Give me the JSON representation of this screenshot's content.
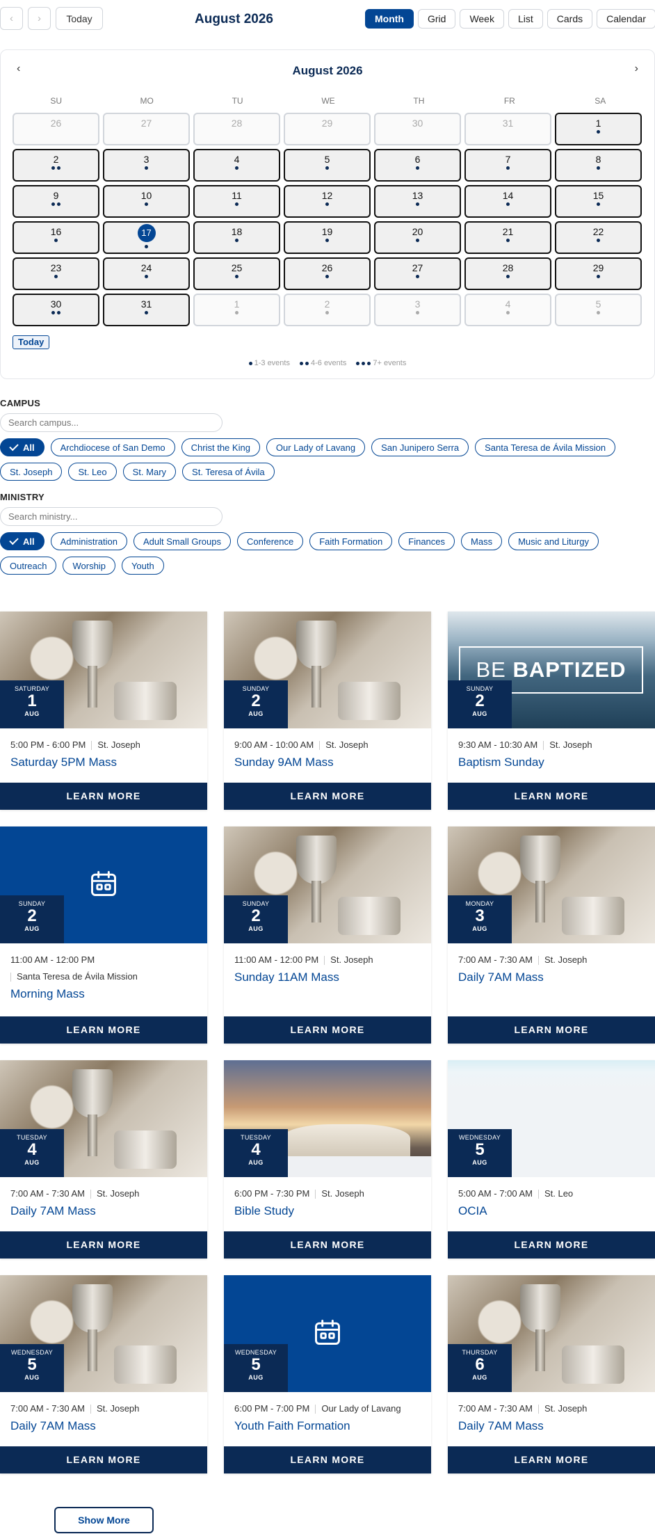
{
  "toolbar": {
    "prev_label": "‹",
    "next_label": "›",
    "today_label": "Today",
    "title": "August 2026",
    "views": [
      {
        "label": "Month",
        "active": true
      },
      {
        "label": "Grid",
        "active": false
      },
      {
        "label": "Week",
        "active": false
      },
      {
        "label": "List",
        "active": false
      },
      {
        "label": "Cards",
        "active": false
      },
      {
        "label": "Calendar",
        "active": false
      }
    ]
  },
  "calendar": {
    "title": "August 2026",
    "prev_label": "‹",
    "next_label": "›",
    "weekdays": [
      "SU",
      "MO",
      "TU",
      "WE",
      "TH",
      "FR",
      "SA"
    ],
    "days": [
      {
        "n": "26",
        "out": true,
        "dots": 0
      },
      {
        "n": "27",
        "out": true,
        "dots": 0
      },
      {
        "n": "28",
        "out": true,
        "dots": 0
      },
      {
        "n": "29",
        "out": true,
        "dots": 0
      },
      {
        "n": "30",
        "out": true,
        "dots": 0
      },
      {
        "n": "31",
        "out": true,
        "dots": 0
      },
      {
        "n": "1",
        "out": false,
        "dots": 1
      },
      {
        "n": "2",
        "out": false,
        "dots": 2
      },
      {
        "n": "3",
        "out": false,
        "dots": 1
      },
      {
        "n": "4",
        "out": false,
        "dots": 1
      },
      {
        "n": "5",
        "out": false,
        "dots": 1
      },
      {
        "n": "6",
        "out": false,
        "dots": 1
      },
      {
        "n": "7",
        "out": false,
        "dots": 1
      },
      {
        "n": "8",
        "out": false,
        "dots": 1
      },
      {
        "n": "9",
        "out": false,
        "dots": 2
      },
      {
        "n": "10",
        "out": false,
        "dots": 1
      },
      {
        "n": "11",
        "out": false,
        "dots": 1
      },
      {
        "n": "12",
        "out": false,
        "dots": 1
      },
      {
        "n": "13",
        "out": false,
        "dots": 1
      },
      {
        "n": "14",
        "out": false,
        "dots": 1
      },
      {
        "n": "15",
        "out": false,
        "dots": 1
      },
      {
        "n": "16",
        "out": false,
        "dots": 1
      },
      {
        "n": "17",
        "out": false,
        "dots": 1,
        "selected": true
      },
      {
        "n": "18",
        "out": false,
        "dots": 1
      },
      {
        "n": "19",
        "out": false,
        "dots": 1
      },
      {
        "n": "20",
        "out": false,
        "dots": 1
      },
      {
        "n": "21",
        "out": false,
        "dots": 1
      },
      {
        "n": "22",
        "out": false,
        "dots": 1
      },
      {
        "n": "23",
        "out": false,
        "dots": 1
      },
      {
        "n": "24",
        "out": false,
        "dots": 1
      },
      {
        "n": "25",
        "out": false,
        "dots": 1
      },
      {
        "n": "26",
        "out": false,
        "dots": 1
      },
      {
        "n": "27",
        "out": false,
        "dots": 1
      },
      {
        "n": "28",
        "out": false,
        "dots": 1
      },
      {
        "n": "29",
        "out": false,
        "dots": 1
      },
      {
        "n": "30",
        "out": false,
        "dots": 2
      },
      {
        "n": "31",
        "out": false,
        "dots": 1
      },
      {
        "n": "1",
        "out": true,
        "dots": 1
      },
      {
        "n": "2",
        "out": true,
        "dots": 1
      },
      {
        "n": "3",
        "out": true,
        "dots": 1
      },
      {
        "n": "4",
        "out": true,
        "dots": 1
      },
      {
        "n": "5",
        "out": true,
        "dots": 1
      }
    ],
    "today_label": "Today",
    "legend": [
      "1-3 events",
      "4-6 events",
      "7+ events"
    ]
  },
  "campus": {
    "title": "CAMPUS",
    "placeholder": "Search campus...",
    "chips": [
      {
        "label": "All",
        "active": true
      },
      {
        "label": "Archdiocese of San Demo",
        "active": false
      },
      {
        "label": "Christ the King",
        "active": false
      },
      {
        "label": "Our Lady of Lavang",
        "active": false
      },
      {
        "label": "San Junipero Serra",
        "active": false
      },
      {
        "label": "Santa Teresa de Ávila Mission",
        "active": false
      },
      {
        "label": "St. Joseph",
        "active": false
      },
      {
        "label": "St. Leo",
        "active": false
      },
      {
        "label": "St. Mary",
        "active": false
      },
      {
        "label": "St. Teresa of Ávila",
        "active": false
      }
    ]
  },
  "ministry": {
    "title": "MINISTRY",
    "placeholder": "Search ministry...",
    "chips": [
      {
        "label": "All",
        "active": true
      },
      {
        "label": "Administration",
        "active": false
      },
      {
        "label": "Adult Small Groups",
        "active": false
      },
      {
        "label": "Conference",
        "active": false
      },
      {
        "label": "Faith Formation",
        "active": false
      },
      {
        "label": "Finances",
        "active": false
      },
      {
        "label": "Mass",
        "active": false
      },
      {
        "label": "Music and Liturgy",
        "active": false
      },
      {
        "label": "Outreach",
        "active": false
      },
      {
        "label": "Worship",
        "active": false
      },
      {
        "label": "Youth",
        "active": false
      }
    ]
  },
  "cards": [
    {
      "image": "chalice",
      "weekday": "SATURDAY",
      "day": "1",
      "month": "AUG",
      "time": "5:00 PM - 6:00 PM",
      "location": "St. Joseph",
      "title": "Saturday 5PM Mass",
      "cta": "LEARN MORE"
    },
    {
      "image": "chalice",
      "weekday": "SUNDAY",
      "day": "2",
      "month": "AUG",
      "time": "9:00 AM - 10:00 AM",
      "location": "St. Joseph",
      "title": "Sunday 9AM Mass",
      "cta": "LEARN MORE"
    },
    {
      "image": "baptized",
      "image_text_1": "BE",
      "image_text_2": "BAPTIZED",
      "weekday": "SUNDAY",
      "day": "2",
      "month": "AUG",
      "time": "9:30 AM - 10:30 AM",
      "location": "St. Joseph",
      "title": "Baptism Sunday",
      "cta": "LEARN MORE"
    },
    {
      "image": "calendar-icon",
      "weekday": "SUNDAY",
      "day": "2",
      "month": "AUG",
      "time": "11:00 AM - 12:00 PM",
      "location": "Santa Teresa de Ávila Mission",
      "location_wrap": true,
      "title": "Morning Mass",
      "cta": "LEARN MORE"
    },
    {
      "image": "chalice",
      "weekday": "SUNDAY",
      "day": "2",
      "month": "AUG",
      "time": "11:00 AM - 12:00 PM",
      "location": "St. Joseph",
      "title": "Sunday 11AM Mass",
      "cta": "LEARN MORE"
    },
    {
      "image": "chalice",
      "weekday": "MONDAY",
      "day": "3",
      "month": "AUG",
      "time": "7:00 AM - 7:30 AM",
      "location": "St. Joseph",
      "title": "Daily 7AM Mass",
      "cta": "LEARN MORE"
    },
    {
      "image": "chalice",
      "weekday": "TUESDAY",
      "day": "4",
      "month": "AUG",
      "time": "7:00 AM - 7:30 AM",
      "location": "St. Joseph",
      "title": "Daily 7AM Mass",
      "cta": "LEARN MORE"
    },
    {
      "image": "bible",
      "weekday": "TUESDAY",
      "day": "4",
      "month": "AUG",
      "time": "6:00 PM - 7:30 PM",
      "location": "St. Joseph",
      "title": "Bible Study",
      "cta": "LEARN MORE"
    },
    {
      "image": "pale",
      "weekday": "WEDNESDAY",
      "day": "5",
      "month": "AUG",
      "time": "5:00 AM - 7:00 AM",
      "location": "St. Leo",
      "title": "OCIA",
      "cta": "LEARN MORE"
    },
    {
      "image": "chalice",
      "weekday": "WEDNESDAY",
      "day": "5",
      "month": "AUG",
      "time": "7:00 AM - 7:30 AM",
      "location": "St. Joseph",
      "title": "Daily 7AM Mass",
      "cta": "LEARN MORE"
    },
    {
      "image": "calendar-icon",
      "weekday": "WEDNESDAY",
      "day": "5",
      "month": "AUG",
      "time": "6:00 PM - 7:00 PM",
      "location": "Our Lady of Lavang",
      "title": "Youth Faith Formation",
      "cta": "LEARN MORE"
    },
    {
      "image": "chalice",
      "weekday": "THURSDAY",
      "day": "6",
      "month": "AUG",
      "time": "7:00 AM - 7:30 AM",
      "location": "St. Joseph",
      "title": "Daily 7AM Mass",
      "cta": "LEARN MORE"
    }
  ],
  "show_more_label": "Show More",
  "colors": {
    "primary": "#034694",
    "navy": "#0b2a55"
  }
}
